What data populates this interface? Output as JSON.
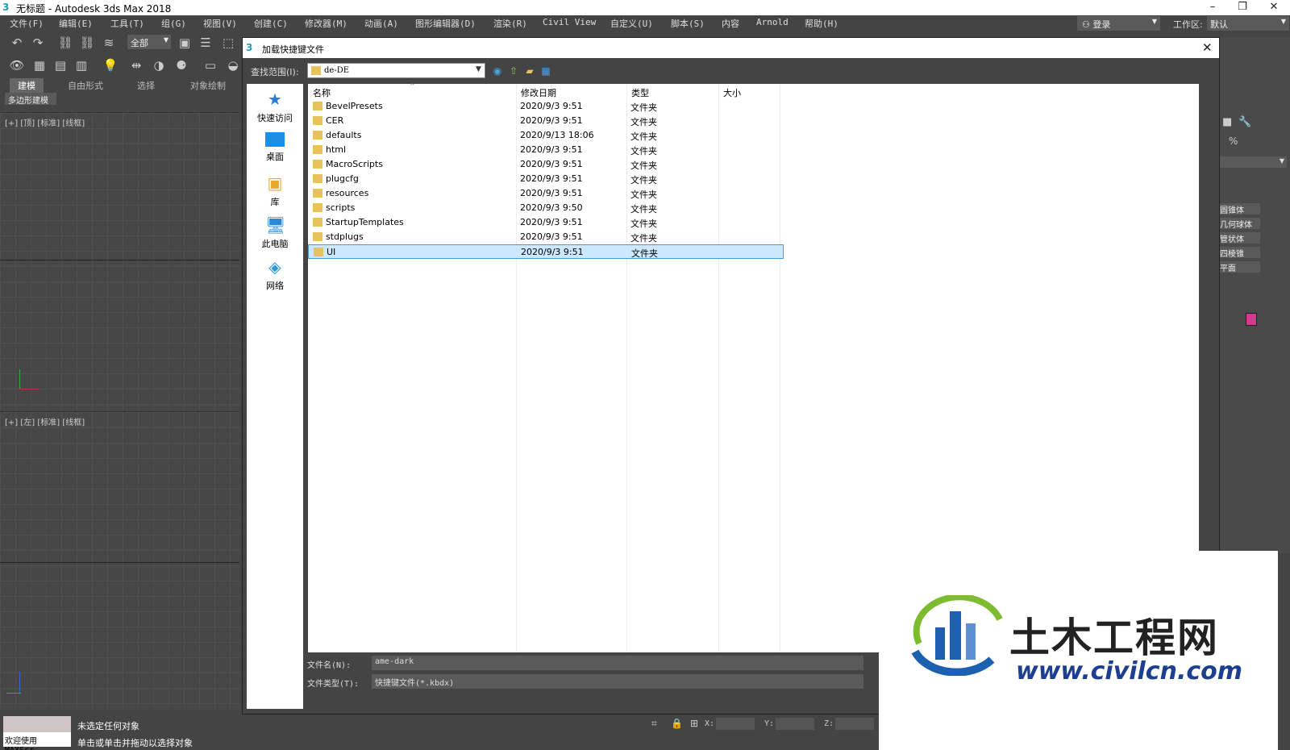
{
  "window": {
    "title": "无标题 - Autodesk 3ds Max 2018",
    "minimize": "–",
    "restore": "❐",
    "close": "✕"
  },
  "menubar": {
    "items": [
      "文件(F)",
      "编辑(E)",
      "工具(T)",
      "组(G)",
      "视图(V)",
      "创建(C)",
      "修改器(M)",
      "动画(A)",
      "图形编辑器(D)",
      "渲染(R)",
      "Civil View",
      "自定义(U)",
      "脚本(S)",
      "内容",
      "Arnold",
      "帮助(H)"
    ],
    "login": "登录",
    "workspace_label": "工作区:",
    "workspace_value": "默认"
  },
  "toolbar": {
    "selection_filter": "全部"
  },
  "ribbon": {
    "tabs": [
      "建模",
      "自由形式",
      "选择",
      "对象绘制"
    ],
    "sub_label": "多边形建模"
  },
  "viewports": {
    "top_label": "[+] [顶] [标准] [线框]",
    "left_label": "[+] [左] [标准] [线框]"
  },
  "command_panel": {
    "items": [
      "圆锥体",
      "几何球体",
      "管状体",
      "四棱锥",
      "平面"
    ],
    "swatch_color": "#d43b8c"
  },
  "status": {
    "welcome": "欢迎使用 MAXScr",
    "line1": "未选定任何对象",
    "line2": "单击或单击并拖动以选择对象",
    "x_label": "X:",
    "y_label": "Y:",
    "z_label": "Z:"
  },
  "dialog": {
    "title": "加载快捷键文件",
    "look_in_label": "查找范围(I):",
    "look_in_value": "de-DE",
    "places": [
      "快速访问",
      "桌面",
      "库",
      "此电脑",
      "网络"
    ],
    "columns": [
      "名称",
      "修改日期",
      "类型",
      "大小"
    ],
    "files": [
      {
        "name": "BevelPresets",
        "date": "2020/9/3 9:51",
        "type": "文件夹"
      },
      {
        "name": "CER",
        "date": "2020/9/3 9:51",
        "type": "文件夹"
      },
      {
        "name": "defaults",
        "date": "2020/9/13 18:06",
        "type": "文件夹"
      },
      {
        "name": "html",
        "date": "2020/9/3 9:51",
        "type": "文件夹"
      },
      {
        "name": "MacroScripts",
        "date": "2020/9/3 9:51",
        "type": "文件夹"
      },
      {
        "name": "plugcfg",
        "date": "2020/9/3 9:51",
        "type": "文件夹"
      },
      {
        "name": "resources",
        "date": "2020/9/3 9:51",
        "type": "文件夹"
      },
      {
        "name": "scripts",
        "date": "2020/9/3 9:50",
        "type": "文件夹"
      },
      {
        "name": "StartupTemplates",
        "date": "2020/9/3 9:51",
        "type": "文件夹"
      },
      {
        "name": "stdplugs",
        "date": "2020/9/3 9:51",
        "type": "文件夹"
      },
      {
        "name": "UI",
        "date": "2020/9/3 9:51",
        "type": "文件夹"
      }
    ],
    "selected_file": "UI",
    "filename_label": "文件名(N):",
    "filename_value": "ame-dark",
    "filetype_label": "文件类型(T):",
    "filetype_value": "快捷键文件(*.kbdx)"
  },
  "watermark": {
    "cn": "土木工程网",
    "url": "www.civilcn.com"
  }
}
